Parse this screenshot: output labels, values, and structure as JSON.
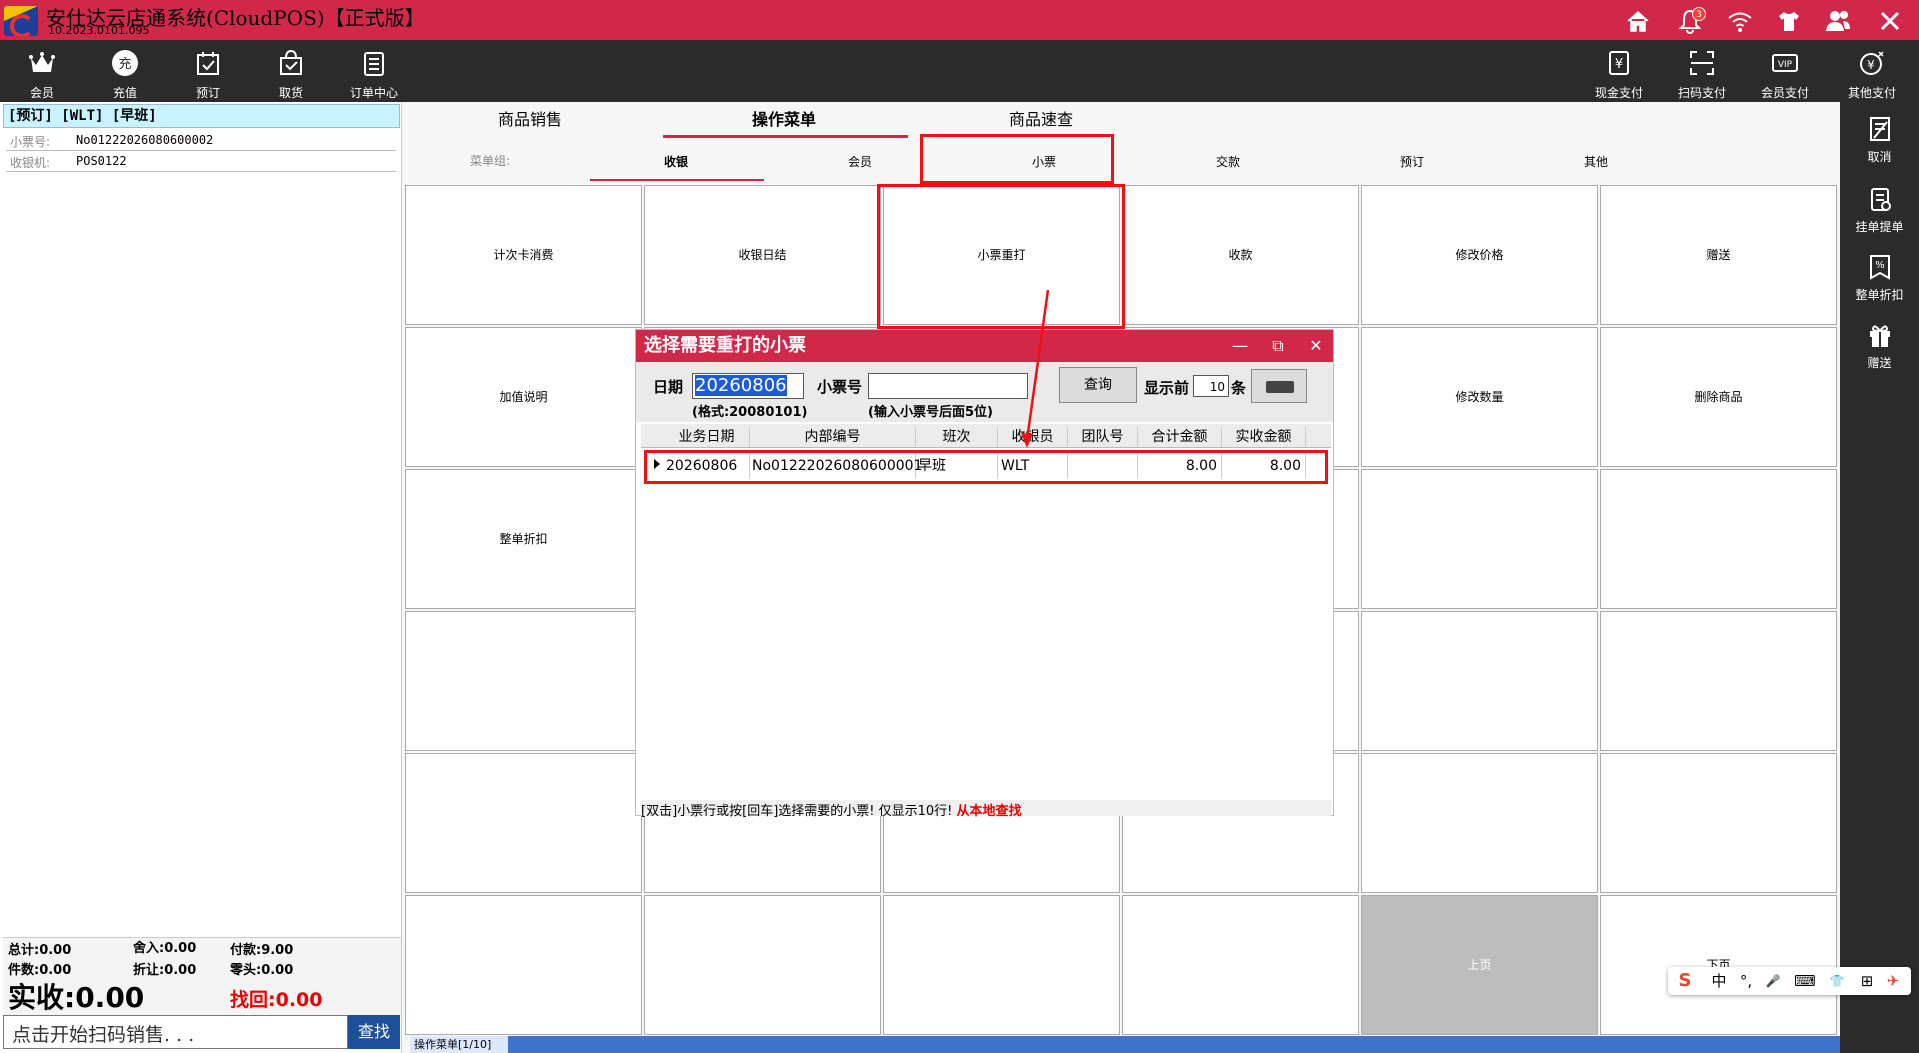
{
  "app": {
    "title": "安仕达云店通系统(CloudPOS)【正式版】",
    "version": "10.2023.0101.095",
    "notification_count": "3"
  },
  "toolbar": {
    "left": [
      {
        "label": "会员",
        "icon": "crown-icon"
      },
      {
        "label": "充值",
        "icon": "recharge-icon",
        "glyph": "充"
      },
      {
        "label": "预订",
        "icon": "calendar-check-icon"
      },
      {
        "label": "取货",
        "icon": "bag-check-icon"
      },
      {
        "label": "订单中心",
        "icon": "clipboard-icon"
      }
    ],
    "right": [
      {
        "label": "现金支付",
        "icon": "cash-icon",
        "glyph": "¥"
      },
      {
        "label": "扫码支付",
        "icon": "scan-icon"
      },
      {
        "label": "会员支付",
        "icon": "vip-icon",
        "glyph": "VIP"
      },
      {
        "label": "其他支付",
        "icon": "other-pay-icon",
        "glyph": "¥"
      }
    ]
  },
  "sidebar_right": [
    {
      "label": "取消",
      "icon": "cancel-doc-icon"
    },
    {
      "label": "挂单提单",
      "icon": "hold-order-icon"
    },
    {
      "label": "整单折扣",
      "icon": "discount-icon"
    },
    {
      "label": "赠送",
      "icon": "gift-icon"
    }
  ],
  "order": {
    "header": "[预订] [WLT] [早班]",
    "ticket_label": "小票号:",
    "ticket_no": "No01222026080600002",
    "register_label": "收银机:",
    "register_no": "POS0122"
  },
  "totals": {
    "total": "总计:0.00",
    "rounding_in": "舍入:0.00",
    "paid": "付款:9.00",
    "count": "件数:0.00",
    "discount": "折让:0.00",
    "odd": "零头:0.00",
    "received": "实收:0.00",
    "change": "找回:0.00"
  },
  "scan": {
    "placeholder": "点击开始扫码销售. . .",
    "find_button": "查找"
  },
  "tabs": {
    "top": [
      "商品销售",
      "操作菜单",
      "商品速查"
    ],
    "active_top": 1,
    "sub_label": "菜单组:",
    "sub": [
      "收银",
      "会员",
      "小票",
      "交款",
      "预订",
      "其他"
    ],
    "active_sub": 0
  },
  "menu_grid": [
    [
      "计次卡消费",
      "收银日结",
      "小票重打",
      "收款",
      "修改价格",
      "赠送"
    ],
    [
      "加值说明",
      "",
      "",
      "",
      "修改数量",
      "删除商品"
    ],
    [
      "整单折扣",
      "",
      "",
      "",
      "",
      ""
    ],
    [
      "",
      "",
      "",
      "",
      "",
      ""
    ],
    [
      "",
      "",
      "",
      "",
      "",
      ""
    ],
    [
      "",
      "",
      "",
      "",
      "上页",
      "下页"
    ]
  ],
  "dialog": {
    "title": "选择需要重打的小票",
    "date_label": "日期",
    "date_value": "20260806",
    "date_hint": "(格式:20080101)",
    "ticket_label": "小票号",
    "ticket_value": "",
    "ticket_hint": "(输入小票号后面5位)",
    "query_button": "查询",
    "show_prefix": "显示前",
    "show_count": "10",
    "show_suffix": "条",
    "columns": [
      "业务日期",
      "内部编号",
      "班次",
      "收银员",
      "团队号",
      "合计金额",
      "实收金额"
    ],
    "rows": [
      [
        "20260806",
        "No01222026080600001",
        "早班",
        "WLT",
        "",
        "8.00",
        "8.00"
      ]
    ],
    "status_text": "[双击]小票行或按[回车]选择需要的小票! 仅显示10行!",
    "status_source": "从本地查找"
  },
  "footer": {
    "page_label": "操作菜单[1/10]"
  },
  "ime": [
    "中",
    "°,",
    "🎤",
    "⌨",
    "👕",
    "⊞"
  ],
  "colors": {
    "brand_red": "#d1284a",
    "toolbar_dark": "#2b2b2b",
    "highlight_box": "#ee1111",
    "selection_blue": "#1e5bd6"
  }
}
